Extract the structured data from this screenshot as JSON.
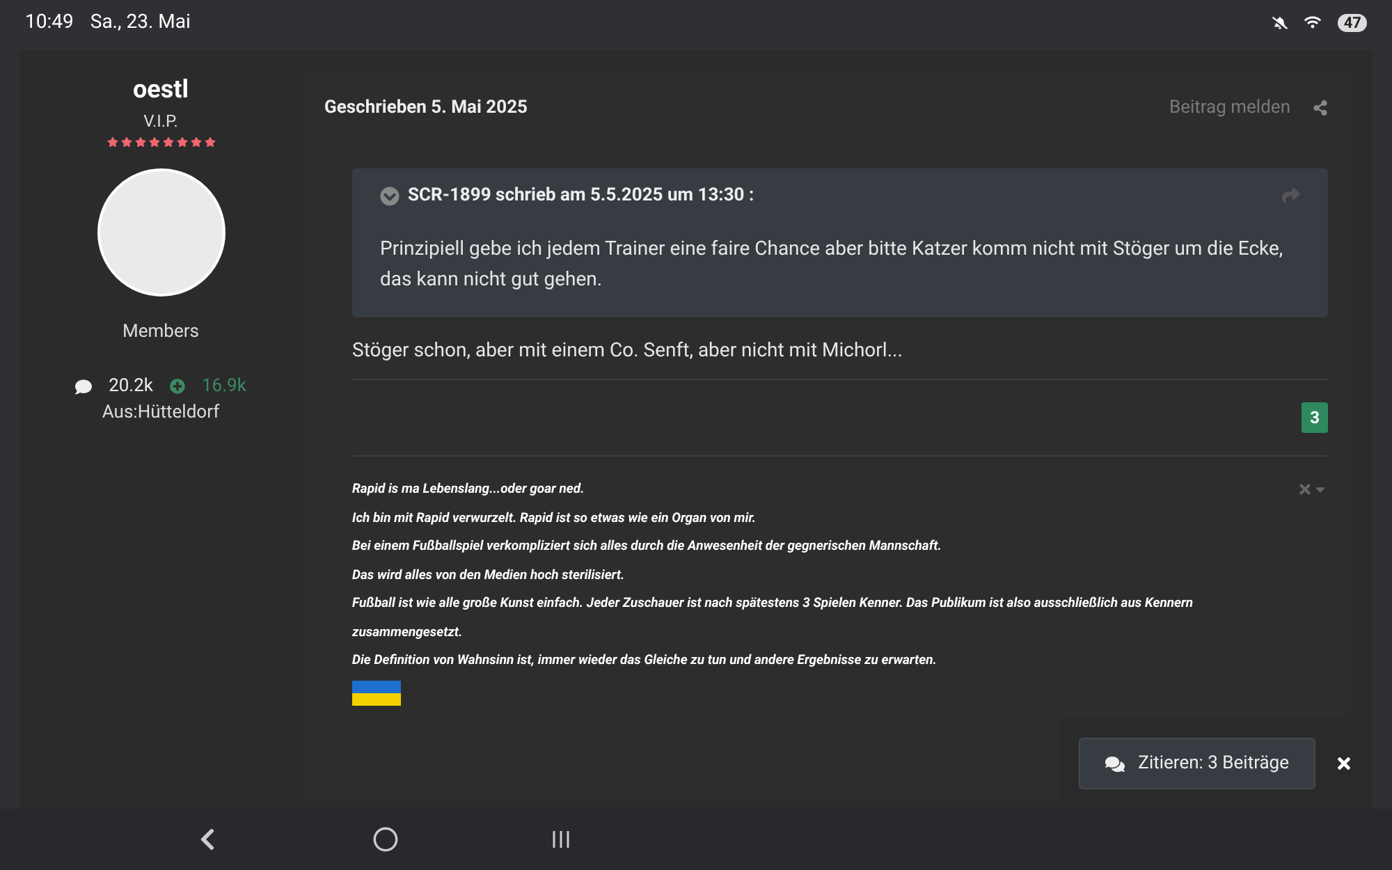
{
  "status_bar": {
    "time": "10:49",
    "date": "Sa., 23. Mai",
    "battery": "47"
  },
  "author": {
    "name": "oestl",
    "rank": "V.I.P.",
    "stars": 8,
    "group": "Members",
    "posts": "20.2k",
    "reputation": "16.9k",
    "location": "Aus:Hütteldorf"
  },
  "post": {
    "date": "Geschrieben 5. Mai 2025",
    "report": "Beitrag melden",
    "quote": {
      "header": "SCR-1899 schrieb am 5.5.2025 um 13:30 :",
      "text": "Prinzipiell gebe ich jedem Trainer eine faire Chance aber bitte Katzer komm nicht mit Stöger um die Ecke, das kann nicht gut gehen."
    },
    "body": "Stöger schon, aber mit einem Co. Senft, aber nicht mit Michorl...",
    "reactions": "3",
    "signature": [
      "Rapid is ma Lebenslang...oder goar ned.",
      "Ich bin mit Rapid verwurzelt. Rapid ist so etwas wie ein Organ von mir.",
      "Bei einem Fußballspiel verkompliziert sich alles durch die Anwesenheit der gegnerischen Mannschaft.",
      "Das wird alles von den Medien hoch sterilisiert.",
      "Fußball ist wie alle große Kunst einfach. Jeder Zuschauer ist nach spätestens 3 Spielen Kenner. Das Publikum ist also ausschließlich aus Kennern zusammengesetzt.",
      "Die Definition von Wahnsinn ist, immer wieder das Gleiche zu tun und andere Ergebnisse zu erwarten."
    ]
  },
  "quote_popup": {
    "label": "Zitieren: 3 Beiträge"
  }
}
